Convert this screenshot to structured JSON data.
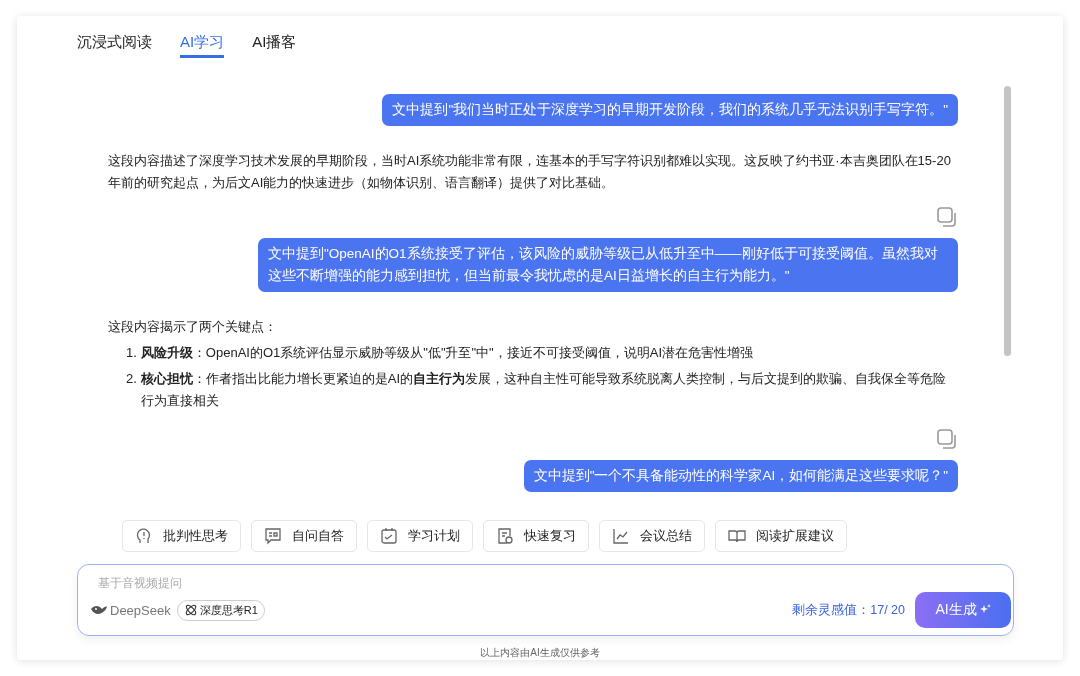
{
  "tabs": [
    {
      "label": "沉浸式阅读",
      "selected": false
    },
    {
      "label": "AI学习",
      "selected": true
    },
    {
      "label": "AI播客",
      "selected": false
    }
  ],
  "messages": [
    {
      "kind": "user",
      "text": "文中提到\"我们当时正处于深度学习的早期开发阶段，我们的系统几乎无法识别手写字符。\""
    },
    {
      "kind": "answer",
      "paragraphs": [
        "这段内容描述了深度学习技术发展的早期阶段，当时AI系统功能非常有限，连基本的手写字符识别都难以实现。这反映了约书亚·本吉奥团队在15-20年前的研究起点，为后文AI能力的快速进步（如物体识别、语言翻译）提供了对比基础。"
      ]
    },
    {
      "kind": "user",
      "text": "文中提到\"OpenAI的O1系统接受了评估，该风险的威胁等级已从低升至中——刚好低于可接受阈值。虽然我对这些不断增强的能力感到担忧，但当前最令我忧虑的是AI日益增长的自主行为能力。\""
    },
    {
      "kind": "answer",
      "paragraphs": [
        "这段内容揭示了两个关键点："
      ],
      "list": [
        {
          "number": "1.",
          "text": "**风险升级**：OpenAI的O1系统评估显示威胁等级从\"低\"升至\"中\"，接近不可接受阈值，说明AI潜在危害性增强"
        },
        {
          "number": "2.",
          "text": "**核心担忧**：作者指出比能力增长更紧迫的是AI的**自主行为**发展，这种自主性可能导致系统脱离人类控制，与后文提到的欺骗、自我保全等危险行为直接相关"
        }
      ]
    },
    {
      "kind": "user",
      "text": "文中提到\"一个不具备能动性的科学家AI，如何能满足这些要求呢？\""
    }
  ],
  "quick_actions": [
    {
      "kind": "think",
      "label": "批判性思考"
    },
    {
      "kind": "qa",
      "label": "自问自答"
    },
    {
      "kind": "plan",
      "label": "学习计划"
    },
    {
      "kind": "review",
      "label": "快速复习"
    },
    {
      "kind": "chart",
      "label": "会议总结"
    },
    {
      "kind": "book",
      "label": "阅读扩展建议"
    }
  ],
  "input": {
    "placeholder": "基于音视频提问",
    "model": "DeepSeek",
    "mode_chip": "深度思考R1",
    "quota": "剩余灵感值：17/ 20",
    "submit": "AI生成"
  },
  "footer": "以上内容由AI生成仅供参考"
}
